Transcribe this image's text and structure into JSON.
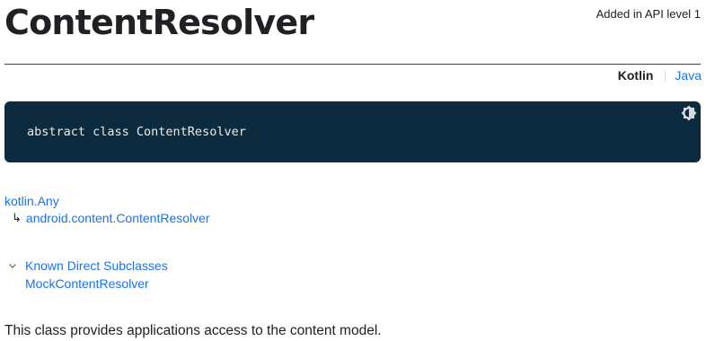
{
  "header": {
    "title": "ContentResolver",
    "api_level": "Added in API level 1"
  },
  "language_switch": {
    "active": "Kotlin",
    "other": "Java"
  },
  "code": {
    "declaration": "abstract class ContentResolver",
    "background": "#0d2b3e"
  },
  "inheritance": {
    "root": "kotlin.Any",
    "arrow": "↳",
    "child": "android.content.ContentResolver"
  },
  "subclasses": {
    "toggle_label": "Known Direct Subclasses",
    "items": [
      "MockContentResolver"
    ]
  },
  "description": "This class provides applications access to the content model.",
  "colors": {
    "link": "#1a73e8",
    "text": "#202124"
  }
}
